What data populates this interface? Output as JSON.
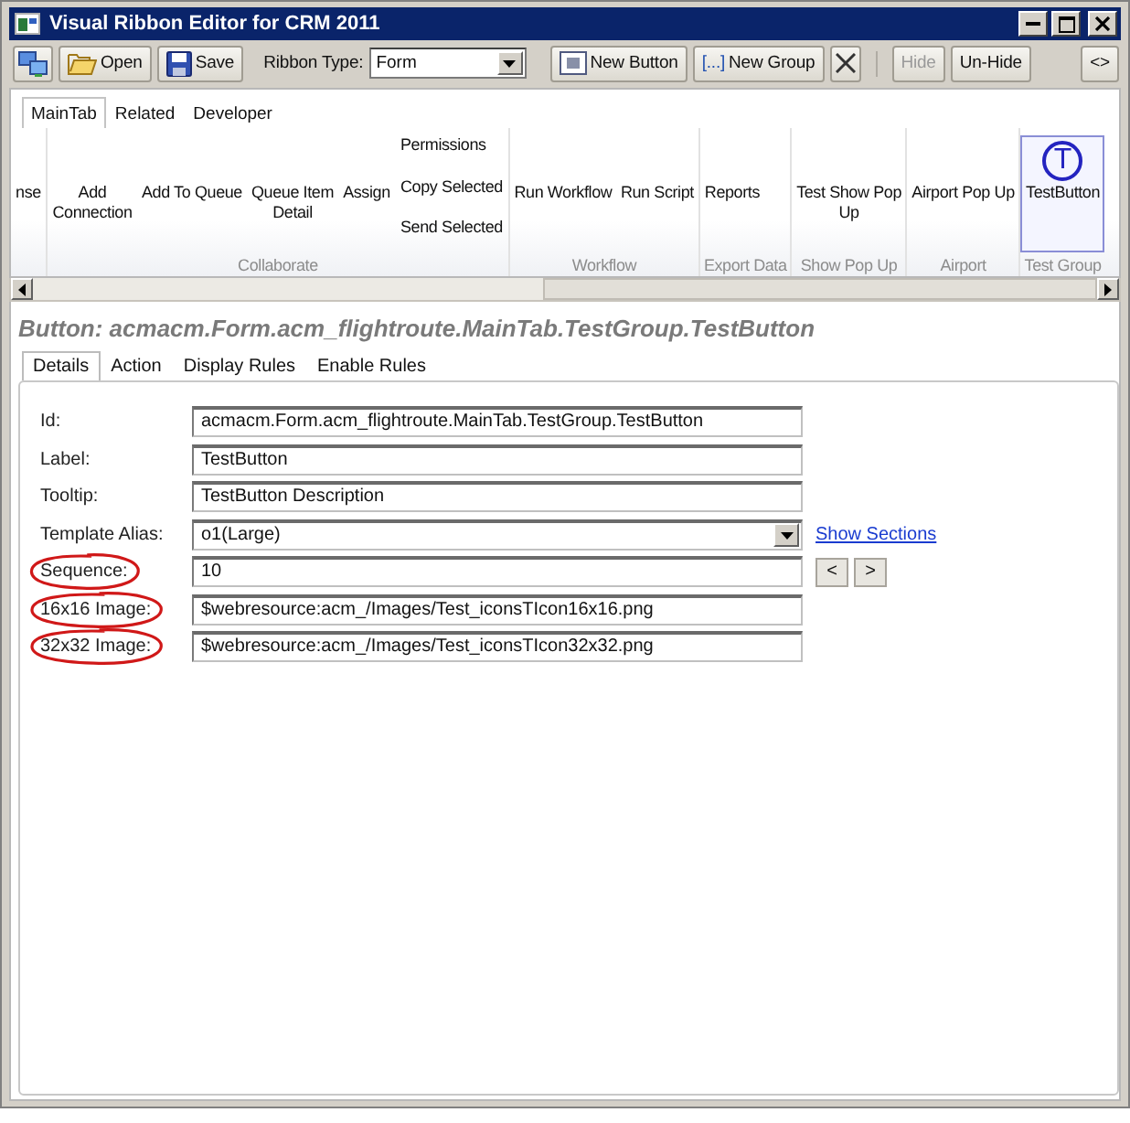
{
  "window": {
    "title": "Visual Ribbon Editor for CRM 2011"
  },
  "toolbar": [
    {
      "kind": "connect",
      "disabled": false
    },
    {
      "kind": "open",
      "label": "Open",
      "disabled": false
    },
    {
      "kind": "save",
      "label": "Save",
      "disabled": false
    },
    {
      "kind": "select",
      "label": "Ribbon Type:",
      "value": "Form"
    },
    {
      "kind": "new-button",
      "label": "New Button",
      "disabled": false
    },
    {
      "kind": "new-group",
      "glyph": "[...]",
      "label": "New Group",
      "disabled": false
    },
    {
      "kind": "delete",
      "disabled": false
    },
    {
      "kind": "separator"
    },
    {
      "kind": "text",
      "label": "Hide",
      "disabled": true
    },
    {
      "kind": "text",
      "label": "Un-Hide",
      "disabled": false
    },
    {
      "kind": "text",
      "label": "<>",
      "disabled": false
    }
  ],
  "ribbon": {
    "tabs": [
      {
        "label": "MainTab",
        "selected": true
      },
      {
        "label": "Related",
        "selected": false
      },
      {
        "label": "Developer",
        "selected": false
      }
    ],
    "groups": [
      {
        "buttons": [
          {
            "kind": "large",
            "label": "nse",
            "selected": false
          }
        ]
      },
      {
        "label": "Collaborate",
        "buttons": [
          {
            "kind": "large",
            "label": "Add Connection",
            "selected": false
          },
          {
            "kind": "large",
            "label": "Add To Queue",
            "selected": false
          },
          {
            "kind": "large",
            "label": "Queue Item Detail",
            "selected": false
          },
          {
            "kind": "large",
            "label": "Assign",
            "selected": false
          },
          {
            "kind": "stack",
            "buttons": [
              {
                "label": "Permissions",
                "selected": false
              },
              {
                "label": "Copy Selected",
                "selected": false
              },
              {
                "label": "Send Selected",
                "selected": false
              }
            ]
          }
        ]
      },
      {
        "label": "Workflow",
        "buttons": [
          {
            "kind": "large",
            "label": "Run Workflow",
            "selected": false
          },
          {
            "kind": "large",
            "label": "Run Script",
            "selected": false
          }
        ]
      },
      {
        "label": "Export Data",
        "buttons": [
          {
            "kind": "large",
            "label": "Reports",
            "selected": false
          }
        ]
      },
      {
        "label": "Show Pop Up",
        "buttons": [
          {
            "kind": "large",
            "label": "Test Show Pop Up",
            "selected": false
          }
        ]
      },
      {
        "label": "Airport",
        "buttons": [
          {
            "kind": "large",
            "label": "Airport Pop Up",
            "selected": false
          }
        ]
      },
      {
        "label": "Test Group",
        "buttons": [
          {
            "kind": "glyph",
            "glyph": "T",
            "label": "TestButton",
            "selected": true
          }
        ]
      }
    ]
  },
  "details": {
    "title": "Button: acmacm.Form.acm_flightroute.MainTab.TestGroup.TestButton",
    "tabs": [
      {
        "label": "Details",
        "selected": true
      },
      {
        "label": "Action",
        "selected": false
      },
      {
        "label": "Display Rules",
        "selected": false
      },
      {
        "label": "Enable Rules",
        "selected": false
      }
    ],
    "fields": [
      {
        "kind": "text",
        "label": "Id:",
        "value": "acmacm.Form.acm_flightroute.MainTab.TestGroup.TestButton",
        "circled": false
      },
      {
        "kind": "text",
        "label": "Label:",
        "value": "TestButton",
        "circled": false
      },
      {
        "kind": "text",
        "label": "Tooltip:",
        "value": "TestButton Description",
        "circled": false
      },
      {
        "kind": "select",
        "label": "Template Alias:",
        "value": "o1(Large)",
        "link": "Show Sections",
        "circled": false
      },
      {
        "kind": "stepper",
        "label": "Sequence:",
        "value": "10",
        "buttons": [
          "<",
          ">"
        ],
        "circled": true
      },
      {
        "kind": "text",
        "label": "16x16 Image:",
        "value": "$webresource:acm_/Images/Test_iconsTIcon16x16.png",
        "circled": true
      },
      {
        "kind": "text",
        "label": "32x32 Image:",
        "value": "$webresource:acm_/Images/Test_iconsTIcon32x32.png",
        "circled": true
      }
    ]
  }
}
